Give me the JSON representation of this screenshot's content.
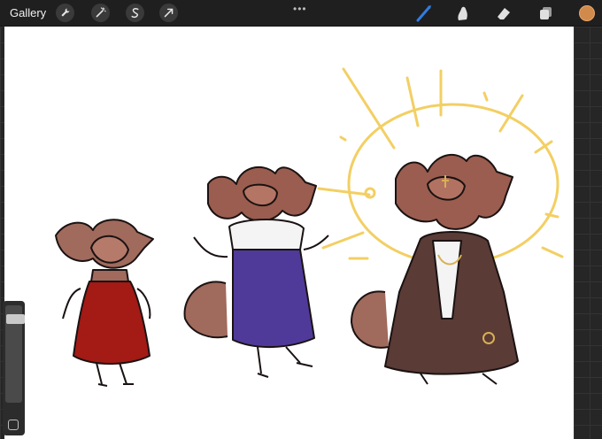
{
  "topbar": {
    "gallery_label": "Gallery",
    "left_tools": [
      {
        "name": "actions",
        "icon": "wrench-icon"
      },
      {
        "name": "adjustments",
        "icon": "magic-wand-icon"
      },
      {
        "name": "selection",
        "icon": "selection-s-icon"
      },
      {
        "name": "transform",
        "icon": "arrow-cursor-icon"
      }
    ],
    "more_dots": "•••",
    "right_tools": [
      {
        "name": "brush",
        "icon": "brush-icon",
        "active": true
      },
      {
        "name": "smudge",
        "icon": "smudge-icon",
        "active": false
      },
      {
        "name": "eraser",
        "icon": "eraser-icon",
        "active": false
      },
      {
        "name": "layers",
        "icon": "layers-icon",
        "active": false
      }
    ],
    "current_color": "#d08a4c",
    "active_tool_color": "#2f7de1"
  },
  "sidebar": {
    "brush_size_level": 0.1,
    "modify_button_icon": "square-icon"
  },
  "colors": {
    "halo": "#f3cf63",
    "fur": "#9a5d4f",
    "red_dress": "#a41a14",
    "blue_skirt": "#4f3a9a",
    "robe": "#5a3b36"
  }
}
